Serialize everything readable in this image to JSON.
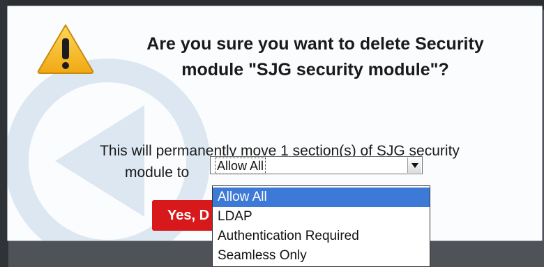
{
  "dialog": {
    "title": "Are you sure you want to delete Security module \"SJG security module\"?",
    "message_line1": "This will permanently move 1 section(s) of SJG security",
    "message_line2": "module to"
  },
  "select": {
    "value": "Allow All",
    "options": [
      "Allow All",
      "LDAP",
      "Authentication Required",
      "Seamless Only"
    ],
    "selected_index": 0
  },
  "buttons": {
    "confirm_label": "Yes, D"
  },
  "icons": {
    "warning": "warning-triangle-icon",
    "watermark": "back-arrow-circle-icon",
    "dropdown_arrow": "chevron-down-icon"
  },
  "colors": {
    "confirm_button": "#d7191c",
    "selection_highlight": "#3d79d6",
    "warning_yellow": "#f2b31b"
  }
}
